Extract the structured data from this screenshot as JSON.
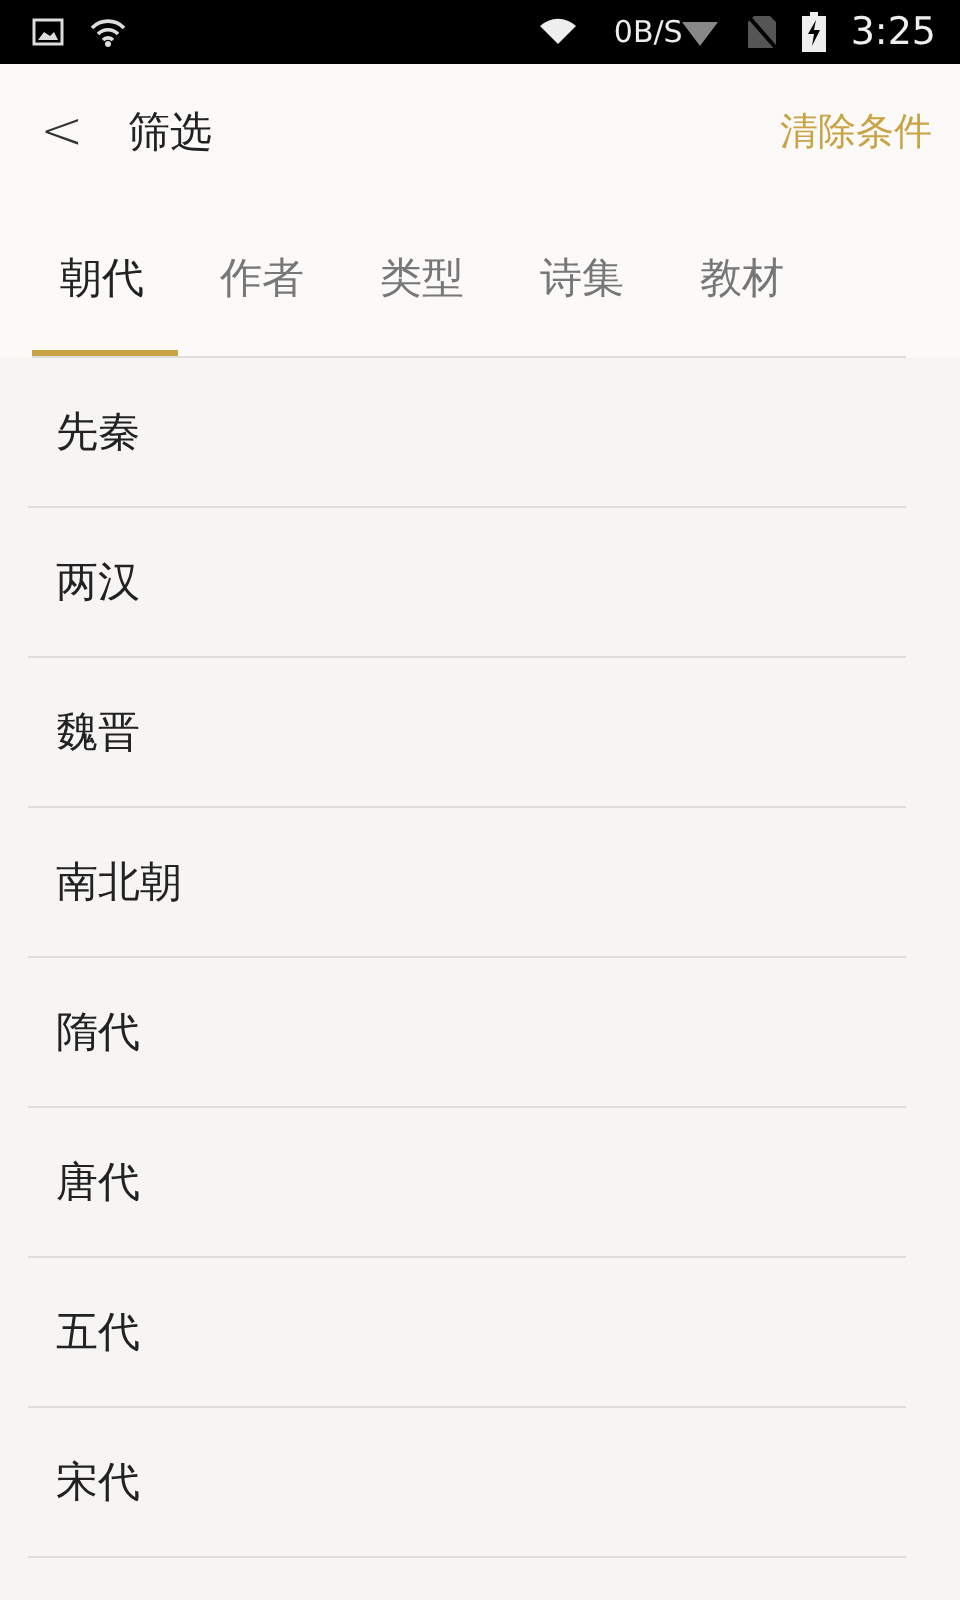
{
  "status_bar": {
    "speed": "0B/S",
    "time": "3:25"
  },
  "header": {
    "back": "<",
    "title": "筛选",
    "action": "清除条件"
  },
  "tabs": [
    {
      "label": "朝代",
      "selected": true
    },
    {
      "label": "作者",
      "selected": false
    },
    {
      "label": "类型",
      "selected": false
    },
    {
      "label": "诗集",
      "selected": false
    },
    {
      "label": "教材",
      "selected": false
    }
  ],
  "items": [
    "先秦",
    "两汉",
    "魏晋",
    "南北朝",
    "隋代",
    "唐代",
    "五代",
    "宋代"
  ]
}
